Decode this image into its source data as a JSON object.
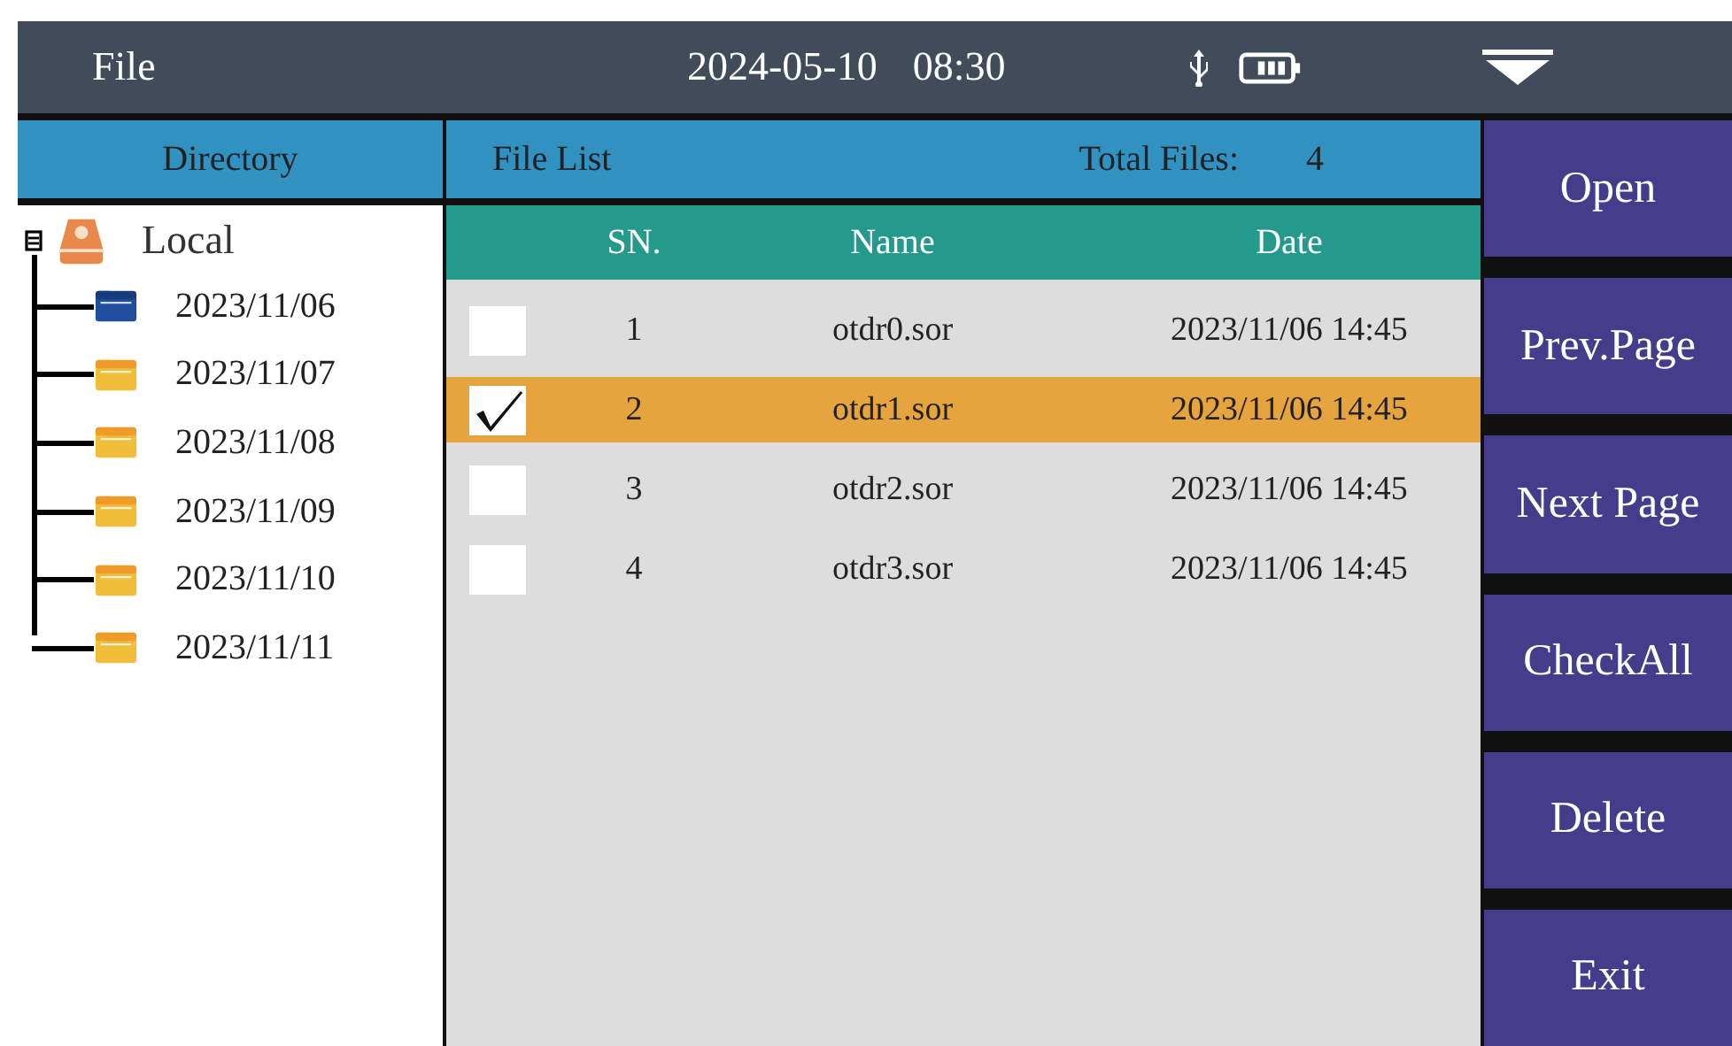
{
  "title_bar": {
    "title": "File",
    "date": "2024-05-10",
    "time": "08:30"
  },
  "directory": {
    "heading": "Directory",
    "root": {
      "label": "Local",
      "expanded": true,
      "children": [
        {
          "label": "2023/11/06",
          "selected": true
        },
        {
          "label": "2023/11/07",
          "selected": false
        },
        {
          "label": "2023/11/08",
          "selected": false
        },
        {
          "label": "2023/11/09",
          "selected": false
        },
        {
          "label": "2023/11/10",
          "selected": false
        },
        {
          "label": "2023/11/11",
          "selected": false
        }
      ]
    }
  },
  "file_list": {
    "heading": "File List",
    "total_label": "Total Files:",
    "total": "4",
    "columns": [
      "SN.",
      "Name",
      "Date"
    ],
    "rows": [
      {
        "sn": "1",
        "name": "otdr0.sor",
        "date": "2023/11/06 14:45",
        "checked": false,
        "selected": false
      },
      {
        "sn": "2",
        "name": "otdr1.sor",
        "date": "2023/11/06 14:45",
        "checked": true,
        "selected": true
      },
      {
        "sn": "3",
        "name": "otdr2.sor",
        "date": "2023/11/06 14:45",
        "checked": false,
        "selected": false
      },
      {
        "sn": "4",
        "name": "otdr3.sor",
        "date": "2023/11/06 14:45",
        "checked": false,
        "selected": false
      }
    ]
  },
  "buttons": [
    "Open",
    "Prev.Page",
    "Next Page",
    "CheckAll",
    "Delete",
    "Exit"
  ]
}
